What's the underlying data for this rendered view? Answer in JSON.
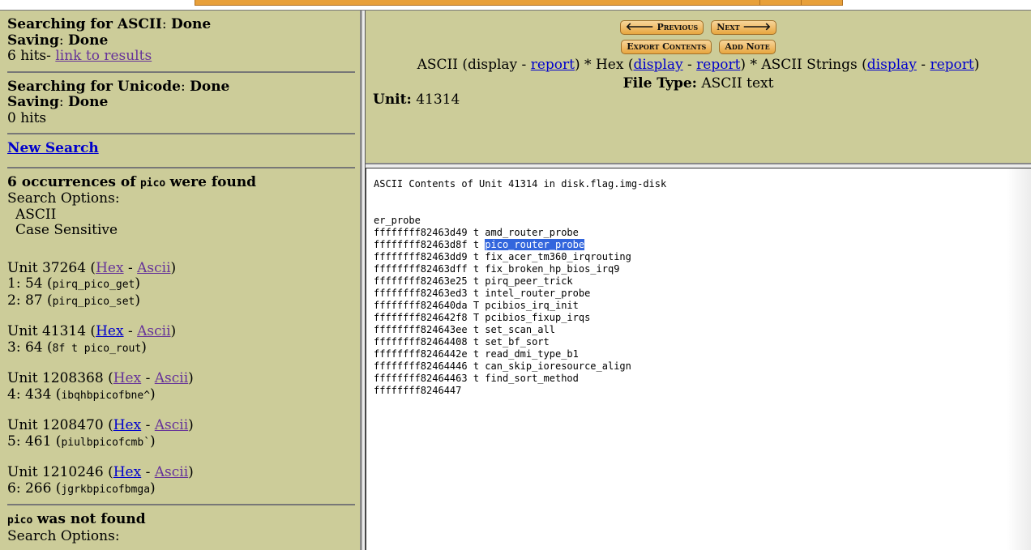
{
  "left": {
    "ascii_search": {
      "label": "Searching for ASCII",
      "status": "Done",
      "saving_label": "Saving",
      "saving_status": "Done",
      "hits": "6 hits",
      "results_link": "link to results"
    },
    "unicode_search": {
      "label": "Searching for Unicode",
      "status": "Done",
      "saving_label": "Saving",
      "saving_status": "Done",
      "hits": "0 hits"
    },
    "new_search": "New Search",
    "occ": {
      "count_text": "6 occurrences of",
      "term": "pico",
      "suffix": "were found",
      "options_label": "Search Options:",
      "opt1": "ASCII",
      "opt2": "Case Sensitive"
    },
    "units": [
      {
        "label": "Unit 37264",
        "hits": [
          {
            "num": "1: 54",
            "ctx": "pirq_pico_get"
          },
          {
            "num": "2: 87",
            "ctx": "pirq_pico_set"
          }
        ]
      },
      {
        "label": "Unit 41314",
        "hits": [
          {
            "num": "3: 64",
            "ctx": "8f t pico_rout"
          }
        ]
      },
      {
        "label": "Unit 1208368",
        "hits": [
          {
            "num": "4: 434",
            "ctx": "ibqhbpicofbne^"
          }
        ]
      },
      {
        "label": "Unit 1208470",
        "hits": [
          {
            "num": "5: 461",
            "ctx": "piulbpicofcmb`"
          }
        ]
      },
      {
        "label": "Unit 1210246",
        "hits": [
          {
            "num": "6: 266",
            "ctx": "jgrkbpicofbmga"
          }
        ]
      }
    ],
    "link_hex": "Hex",
    "link_ascii": "Ascii",
    "notfound": {
      "term": "pico",
      "text": "was not found",
      "options_label": "Search Options:"
    }
  },
  "right": {
    "buttons": {
      "previous": "Previous",
      "next": "Next",
      "export": "Export Contents",
      "add_note": "Add Note"
    },
    "modes": {
      "ascii": "ASCII",
      "hex": "Hex",
      "strings": "ASCII Strings",
      "display": "display",
      "report": "report"
    },
    "file_type_label": "File Type:",
    "file_type": "ASCII text",
    "unit_label": "Unit:",
    "unit_value": "41314",
    "content_header": "ASCII Contents of Unit 41314 in disk.flag.img-disk",
    "content_before": "er_probe\nffffffff82463d49 t amd_router_probe\nffffffff82463d8f t ",
    "content_highlight": "pico_router_probe",
    "content_after": "\nffffffff82463dd9 t fix_acer_tm360_irqrouting\nffffffff82463dff t fix_broken_hp_bios_irq9\nffffffff82463e25 t pirq_peer_trick\nffffffff82463ed3 t intel_router_probe\nffffffff824640da T pcibios_irq_init\nffffffff824642f8 T pcibios_fixup_irqs\nffffffff824643ee t set_scan_all\nffffffff82464408 t set_bf_sort\nffffffff8246442e t read_dmi_type_b1\nffffffff82464446 t can_skip_ioresource_align\nffffffff82464463 t find_sort_method\nffffffff8246447"
  }
}
